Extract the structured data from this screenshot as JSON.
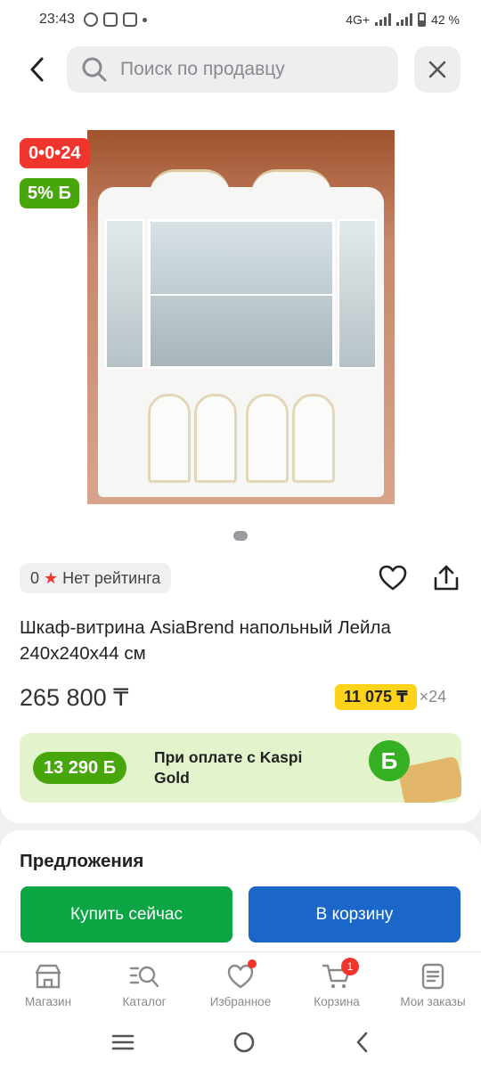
{
  "status_bar": {
    "time": "23:43",
    "network": "4G+",
    "battery": "42 %"
  },
  "search": {
    "placeholder": "Поиск по продавцу"
  },
  "product": {
    "timer_badge": "0•0•24",
    "bonus_badge": "5% Б",
    "rating_value": "0",
    "rating_text": "Нет рейтинга",
    "title": "Шкаф-витрина AsiaBrend напольный Лейла 240x240x44 см",
    "price": "265 800 ₸",
    "installment_amount": "11 075 ₸",
    "installment_months": "×24"
  },
  "kaspi_gold": {
    "amount": "13 290 Б",
    "text": "При оплате с Kaspi Gold",
    "coin_glyph": "Б"
  },
  "offers": {
    "heading": "Предложения",
    "buy_now": "Купить сейчас",
    "add_to_cart": "В корзину"
  },
  "tab_bar": {
    "items": [
      {
        "label": "Магазин",
        "icon": "store-icon"
      },
      {
        "label": "Каталог",
        "icon": "catalog-search-icon"
      },
      {
        "label": "Избранное",
        "icon": "heart-icon",
        "dot": true
      },
      {
        "label": "Корзина",
        "icon": "cart-icon",
        "badge": "1"
      },
      {
        "label": "Мои заказы",
        "icon": "orders-icon"
      }
    ]
  },
  "colors": {
    "accent_red": "#f0352c",
    "bonus_green": "#46a60b",
    "buy_green": "#0ba544",
    "cart_blue": "#1a67c9",
    "installment_yellow": "#ffd31a"
  }
}
